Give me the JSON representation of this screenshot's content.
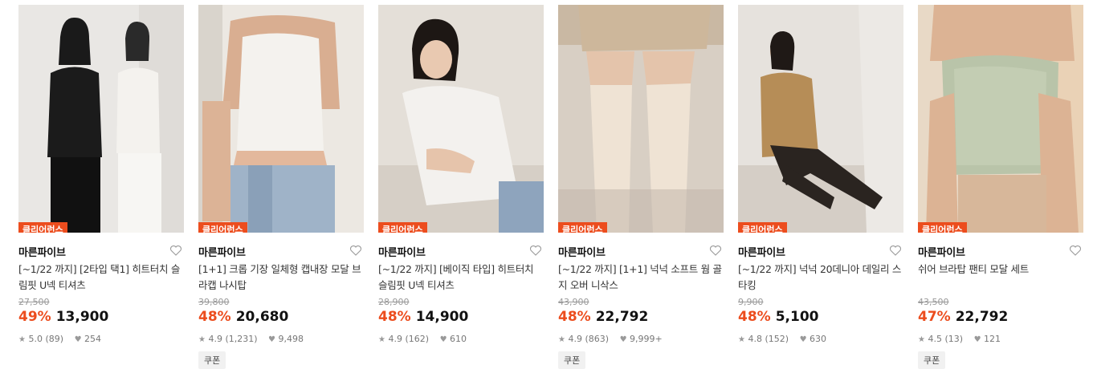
{
  "badge_label": "클리어런스",
  "coupon_label": "쿠폰",
  "products": [
    {
      "brand": "마른파이브",
      "title": "[~1/22 까지] [2타입 택1] 히트터치 슬림핏 U넥 티셔츠",
      "original_price": "27,500",
      "discount": "49%",
      "price": "13,900",
      "rating": "5.0",
      "reviews": "(89)",
      "likes": "254",
      "has_coupon": false,
      "image_desc": "two-women-black-white-tshirts"
    },
    {
      "brand": "마른파이브",
      "title": "[1+1] 크롭 기장 일체형 캡내장 모달 브라캡 나시탑",
      "original_price": "39,800",
      "discount": "48%",
      "price": "20,680",
      "rating": "4.9",
      "reviews": "(1,231)",
      "likes": "9,498",
      "has_coupon": true,
      "image_desc": "white-crop-tank-jeans"
    },
    {
      "brand": "마른파이브",
      "title": "[~1/22 까지] [베이직 타입] 히트터치 슬림핏 U넥 티셔츠",
      "original_price": "28,900",
      "discount": "48%",
      "price": "14,900",
      "rating": "4.9",
      "reviews": "(162)",
      "likes": "610",
      "has_coupon": false,
      "image_desc": "woman-white-longsleeve"
    },
    {
      "brand": "마른파이브",
      "title": "[~1/22 까지] [1+1] 넉넉 소프트 웜 골지 오버 니삭스",
      "original_price": "43,900",
      "discount": "48%",
      "price": "22,792",
      "rating": "4.9",
      "reviews": "(863)",
      "likes": "9,999+",
      "has_coupon": true,
      "image_desc": "beige-over-knee-socks"
    },
    {
      "brand": "마른파이브",
      "title": "[~1/22 까지] 넉넉 20데니아 데일리 스타킹",
      "original_price": "9,900",
      "discount": "48%",
      "price": "5,100",
      "rating": "4.8",
      "reviews": "(152)",
      "likes": "630",
      "has_coupon": false,
      "image_desc": "woman-sitting-black-stockings"
    },
    {
      "brand": "마른파이브",
      "title": "쉬어 브라탑 팬티 모달 세트",
      "original_price": "43,500",
      "discount": "47%",
      "price": "22,792",
      "rating": "4.5",
      "reviews": "(13)",
      "likes": "121",
      "has_coupon": true,
      "image_desc": "sage-green-bratop-set"
    }
  ],
  "colors": {
    "accent": "#ec4d1e",
    "price": "#111111",
    "muted": "#999999"
  }
}
